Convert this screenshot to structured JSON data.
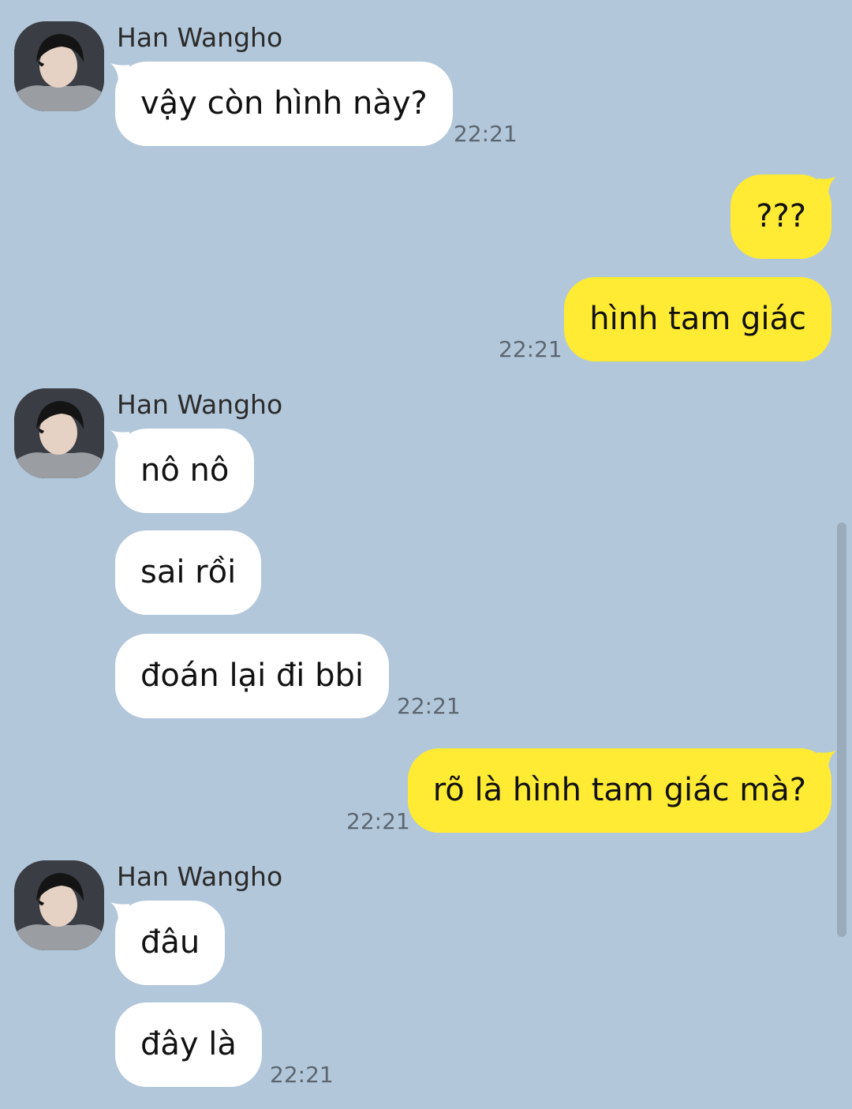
{
  "messages": [
    {
      "sender": "Han Wangho",
      "bubbles": [
        "vậy còn hình này?"
      ],
      "time": "22:21"
    },
    {
      "sender": "me",
      "bubbles": [
        "???",
        "hình tam giác"
      ],
      "time": "22:21"
    },
    {
      "sender": "Han Wangho",
      "bubbles": [
        "nô nô",
        "sai rồi",
        "đoán lại đi bbi"
      ],
      "time": "22:21"
    },
    {
      "sender": "me",
      "bubbles": [
        "rõ là hình tam giác mà?"
      ],
      "time": "22:21"
    },
    {
      "sender": "Han Wangho",
      "bubbles": [
        "đâu",
        "đây là"
      ],
      "time": "22:21"
    }
  ],
  "colors": {
    "background": "#b2c7da",
    "incoming_bubble": "#ffffff",
    "outgoing_bubble": "#ffeb33"
  }
}
